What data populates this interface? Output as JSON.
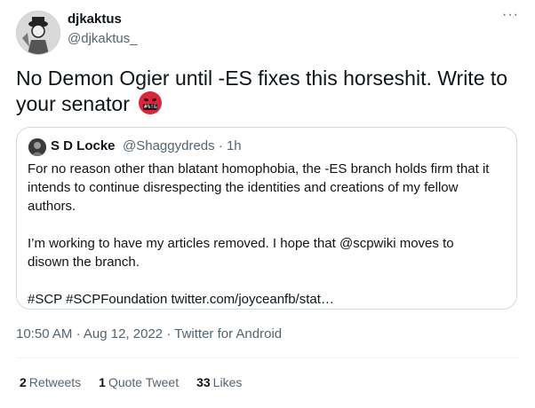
{
  "author": {
    "display_name": "djkaktus",
    "handle": "@djkaktus_",
    "more_label": "···"
  },
  "tweet": {
    "text": "No Demon Ogier until -ES fixes this horseshit. Write to your senator",
    "emoji": "🤬"
  },
  "quote": {
    "name": "S D Locke",
    "handle_time": "@Shaggydreds · 1h",
    "paragraphs": [
      "For no reason other than blatant homophobia, the -ES branch holds firm that it intends to continue disrespecting the identities and creations of my fellow authors.",
      "I’m working to have my articles removed. I hope that @scpwiki moves to disown the branch.",
      "#SCP #SCPFoundation twitter.com/joyceanfb/stat…"
    ]
  },
  "meta": {
    "time": "10:50 AM",
    "date": "Aug 12, 2022",
    "source": "Twitter for Android"
  },
  "stats": {
    "retweets_count": "2",
    "retweets_label": "Retweets",
    "quotes_count": "1",
    "quotes_label": "Quote Tweet",
    "likes_count": "33",
    "likes_label": "Likes"
  },
  "colors": {
    "text": "#0f1419",
    "secondary": "#536471",
    "border": "#cfd9de",
    "emoji_red": "#d7263d"
  }
}
